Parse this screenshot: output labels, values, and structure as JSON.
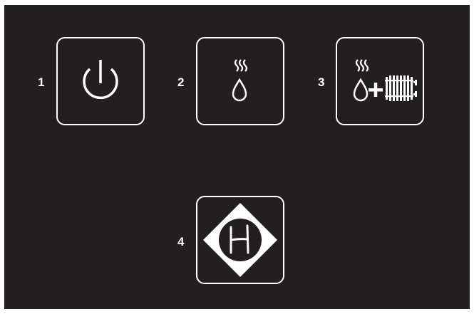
{
  "panel": {
    "background": "#231f20",
    "foreground": "#ffffff"
  },
  "buttons": [
    {
      "number": "1",
      "icon": "power-icon"
    },
    {
      "number": "2",
      "icon": "hot-water-icon"
    },
    {
      "number": "3",
      "icon": "hot-water-plus-heating-icon"
    },
    {
      "number": "4",
      "icon": "diamond-h-icon"
    }
  ]
}
